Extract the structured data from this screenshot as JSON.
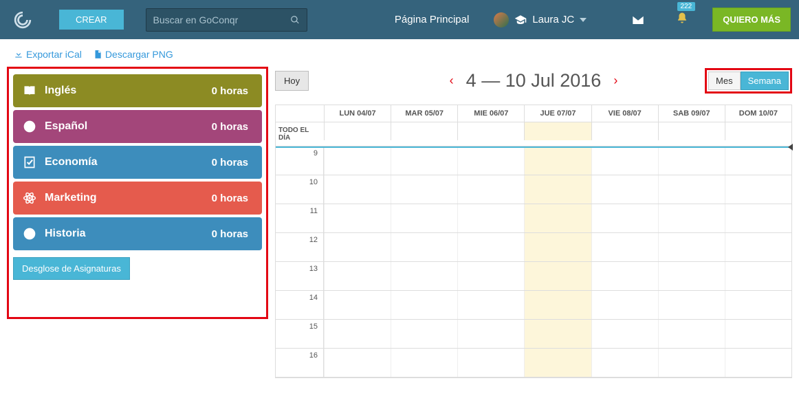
{
  "header": {
    "create": "CREAR",
    "search_placeholder": "Buscar en GoConqr",
    "home": "Página Principal",
    "user": "Laura JC",
    "notif_count": "222",
    "more": "QUIERO MÁS"
  },
  "subbar": {
    "export": "Exportar iCal",
    "download": "Descargar PNG"
  },
  "subjects": [
    {
      "name": "Inglés",
      "hours": "0 horas",
      "color": "c-olive",
      "icon": "book"
    },
    {
      "name": "Español",
      "hours": "0 horas",
      "color": "c-plum",
      "icon": "help"
    },
    {
      "name": "Economía",
      "hours": "0 horas",
      "color": "c-blue",
      "icon": "check"
    },
    {
      "name": "Marketing",
      "hours": "0 horas",
      "color": "c-red",
      "icon": "atom"
    },
    {
      "name": "Historia",
      "hours": "0 horas",
      "color": "c-blue2",
      "icon": "help"
    }
  ],
  "desglose": "Desglose de Asignaturas",
  "calendar": {
    "today": "Hoy",
    "title": "4 — 10 Jul 2016",
    "view_month": "Mes",
    "view_week": "Semana",
    "allday": "TODO EL DÍA",
    "days": [
      "LUN 04/07",
      "MAR 05/07",
      "MIE 06/07",
      "JUE 07/07",
      "VIE 08/07",
      "SAB 09/07",
      "DOM 10/07"
    ],
    "today_index": 3,
    "hours": [
      "9",
      "10",
      "11",
      "12",
      "13",
      "14",
      "15",
      "16"
    ]
  }
}
